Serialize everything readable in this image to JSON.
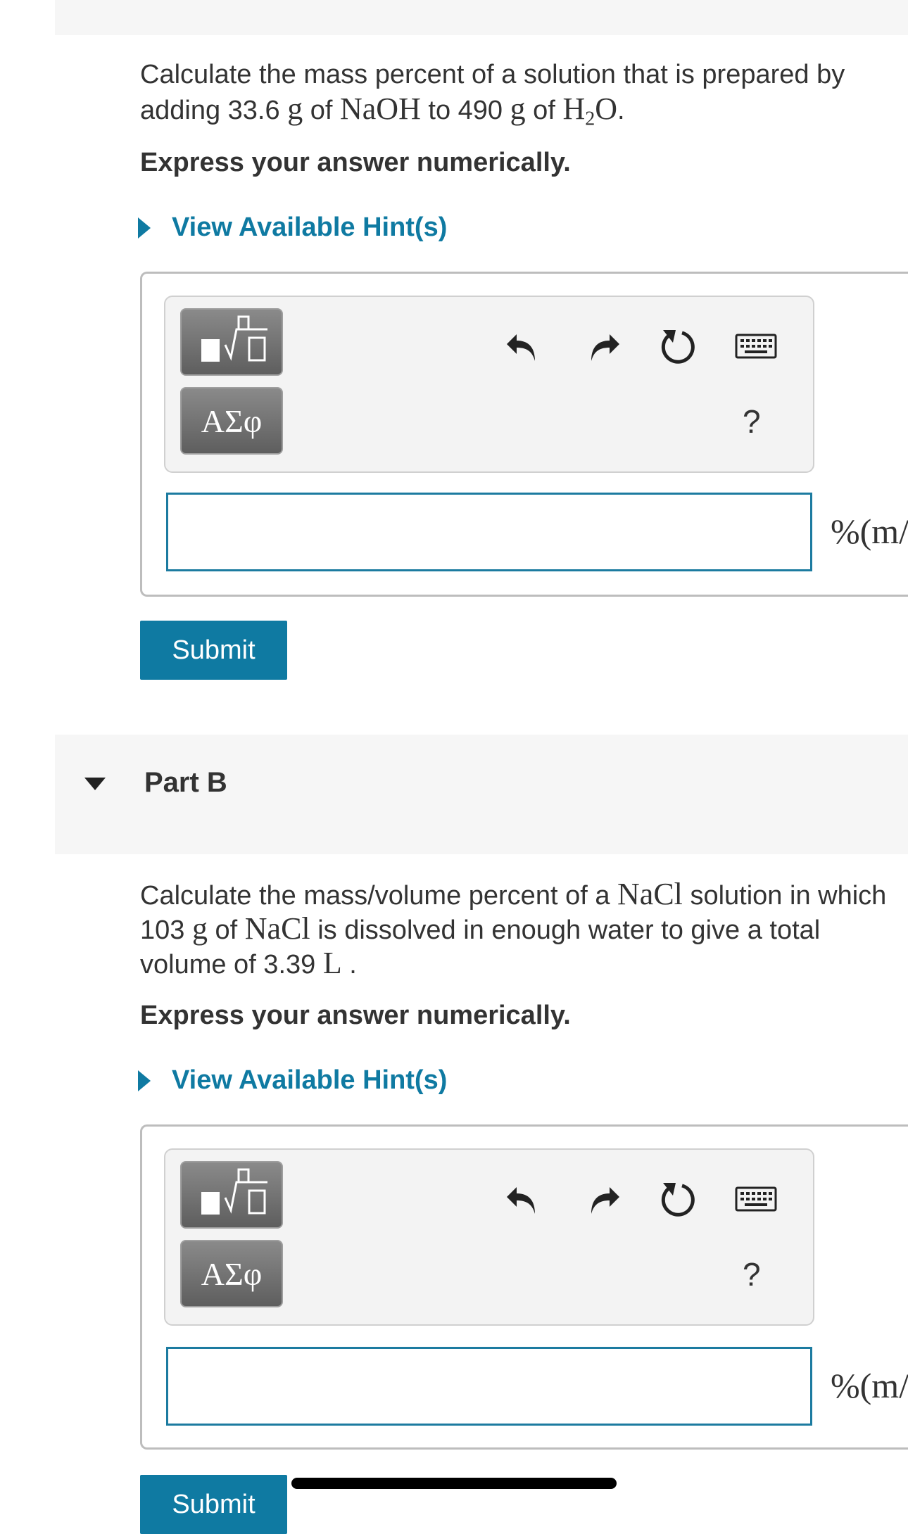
{
  "partA": {
    "question": {
      "t1": "Calculate the mass percent of a solution that is prepared by",
      "t2": "adding 33.6 ",
      "m_g1": "g",
      "t3": " of ",
      "m_naoh": "NaOH",
      "t4": " to 490 ",
      "m_g2": "g",
      "t5": " of ",
      "m_h": "H",
      "m_sub": "2",
      "m_o": "O",
      "t6": "."
    },
    "instruction": "Express your answer numerically.",
    "hint_label": "View Available Hint(s)",
    "toolbar": {
      "greek_label": "ΑΣφ",
      "help_label": "?"
    },
    "answer_value": "",
    "units": "%(m/",
    "submit_label": "Submit"
  },
  "partB": {
    "label": "Part B",
    "question": {
      "t1": "Calculate the mass/volume percent of a ",
      "m_nacl1": "NaCl",
      "t2": " solution in which",
      "t3": "103 ",
      "m_g": "g",
      "t4": " of ",
      "m_nacl2": "NaCl",
      "t5": " is dissolved in enough water to give a total",
      "t6": "volume of 3.39 ",
      "m_l": "L",
      "t7": " ."
    },
    "instruction": "Express your answer numerically.",
    "hint_label": "View Available Hint(s)",
    "toolbar": {
      "greek_label": "ΑΣφ",
      "help_label": "?"
    },
    "answer_value": "",
    "units": "%(m/",
    "submit_label": "Submit"
  },
  "icons": {
    "templates": "templates-icon",
    "undo": "undo-icon",
    "redo": "redo-icon",
    "reset": "reset-icon",
    "keyboard": "keyboard-icon",
    "part_toggle": "caret-down-icon",
    "hint_toggle": "caret-right-icon"
  },
  "colors": {
    "accent": "#0f7aa2",
    "input_border": "#1c7ba0",
    "band": "#f6f6f6"
  }
}
